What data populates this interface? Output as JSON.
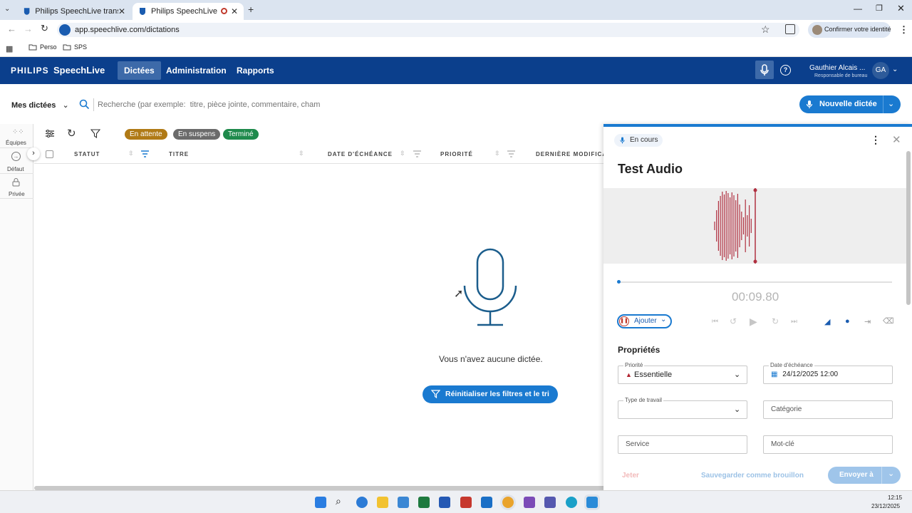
{
  "browser": {
    "tabs": [
      {
        "label": "Philips SpeechLive transcrit vo"
      },
      {
        "label": "Philips SpeechLive"
      }
    ],
    "url": "app.speechlive.com/dictations",
    "profile_label": "Confirmer votre identité",
    "bookmarks": [
      {
        "label": "Perso"
      },
      {
        "label": "SPS"
      }
    ]
  },
  "app": {
    "brand": "PHILIPS",
    "product": "SpeechLive",
    "nav": [
      {
        "label": "Dictées"
      },
      {
        "label": "Administration"
      },
      {
        "label": "Rapports"
      }
    ],
    "user_name": "Gauthier Alcais ...",
    "user_role": "Responsable de bureau",
    "user_initials": "GA"
  },
  "toolbar": {
    "scope_label": "Mes dictées",
    "search_placeholder": "Recherche (par exemple:  titre, pièce jointe, commentaire, champ",
    "new_button": "Nouvelle dictée"
  },
  "filters": {
    "pills": [
      {
        "label": "En attente",
        "color": "#b07a16"
      },
      {
        "label": "En suspens",
        "color": "#6b6b6b"
      },
      {
        "label": "Terminé",
        "color": "#1f8a4c"
      }
    ]
  },
  "sidebar": {
    "items": [
      {
        "label": "Équipes"
      },
      {
        "label": "Défaut"
      },
      {
        "label": "Privée"
      }
    ]
  },
  "table": {
    "headers": [
      "STATUT",
      "TITRE",
      "DATE D'ÉCHÉANCE",
      "PRIORITÉ",
      "DERNIÈRE MODIFICA"
    ]
  },
  "empty": {
    "message": "Vous n'avez aucune dictée.",
    "reset_button": "Réinitialiser les filtres et le tri"
  },
  "panel": {
    "status": "En cours",
    "title": "Test Audio",
    "time": "00:09.80",
    "record_button": "Ajouter",
    "properties_heading": "Propriétés",
    "priority_label": "Priorité",
    "priority_value": "Essentielle",
    "due_label": "Date d'échéance",
    "due_value": "24/12/2025 12:00",
    "worktype_label": "Type de travail",
    "category_placeholder": "Catégorie",
    "service_placeholder": "Service",
    "keyword_placeholder": "Mot-clé",
    "discard_button": "Jeter",
    "draft_button": "Sauvegarder comme brouillon",
    "send_button": "Envoyer à"
  },
  "taskbar": {
    "time": "12:15",
    "date": "23/12/2025"
  },
  "colors": {
    "brand_blue": "#0b3f8c",
    "accent_blue": "#1a7ad0",
    "waveform": "#b03040"
  }
}
